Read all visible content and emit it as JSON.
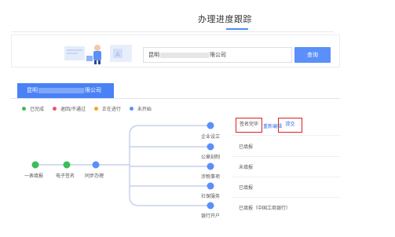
{
  "header": {
    "title": "办理进度跟踪"
  },
  "search": {
    "value_prefix": "昆明",
    "value_suffix": "限公司",
    "button_label": "查询"
  },
  "company_tab": {
    "prefix": "昆明",
    "suffix": "限公司"
  },
  "legend": [
    {
      "label": "已完成",
      "color": "#3cbd5a"
    },
    {
      "label": "退回/不通过",
      "color": "#f0506e"
    },
    {
      "label": "正在进行",
      "color": "#f5a623"
    },
    {
      "label": "未开始",
      "color": "#5b8ff9"
    }
  ],
  "flow": {
    "main_steps": [
      "一表填报",
      "电子签名",
      "同步办理"
    ],
    "main_step_status": [
      "completed",
      "completed",
      "not_started"
    ],
    "branches": [
      {
        "name": "企业设立",
        "status": "签名完毕",
        "actions": [
          "重新编辑",
          "提交"
        ]
      },
      {
        "name": "公章刻制",
        "status": "已填报"
      },
      {
        "name": "涉税事项",
        "status": "未填报"
      },
      {
        "name": "社保服务",
        "status": "已填报"
      },
      {
        "name": "银行开户",
        "status": "已填报（中国工商银行）"
      }
    ]
  }
}
